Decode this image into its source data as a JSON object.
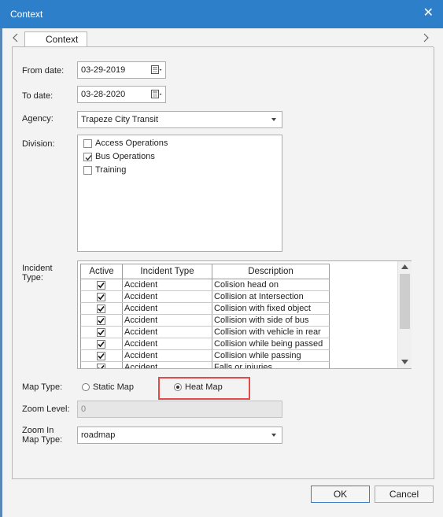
{
  "window": {
    "title": "Context",
    "close_glyph": "✕"
  },
  "tabs": [
    {
      "label": "Context",
      "active": true
    }
  ],
  "form": {
    "from_date": {
      "label": "From date:",
      "value": "03-29-2019"
    },
    "to_date": {
      "label": "To date:",
      "value": "03-28-2020"
    },
    "agency": {
      "label": "Agency:",
      "value": "Trapeze City Transit"
    },
    "division": {
      "label": "Division:",
      "items": [
        {
          "label": "Access Operations",
          "checked": false
        },
        {
          "label": "Bus Operations",
          "checked": true
        },
        {
          "label": "Training",
          "checked": false
        }
      ]
    },
    "incident_type": {
      "label_line1": "Incident",
      "label_line2": "Type:",
      "columns": [
        "Active",
        "Incident Type",
        "Description"
      ],
      "rows": [
        {
          "active": true,
          "type": "Accident",
          "description": "Colision head on"
        },
        {
          "active": true,
          "type": "Accident",
          "description": "Collision at Intersection"
        },
        {
          "active": true,
          "type": "Accident",
          "description": "Collision with fixed object"
        },
        {
          "active": true,
          "type": "Accident",
          "description": "Collision with side of bus"
        },
        {
          "active": true,
          "type": "Accident",
          "description": "Collision with vehicle in rear"
        },
        {
          "active": true,
          "type": "Accident",
          "description": "Collision while being passed"
        },
        {
          "active": true,
          "type": "Accident",
          "description": "Collision while passing"
        },
        {
          "active": true,
          "type": "Accident",
          "description": "Falls or injuries"
        }
      ]
    },
    "map_type": {
      "label": "Map Type:",
      "options": [
        {
          "label": "Static Map",
          "selected": false
        },
        {
          "label": "Heat Map",
          "selected": true
        }
      ]
    },
    "zoom_level": {
      "label": "Zoom Level:",
      "value": "0"
    },
    "zoom_in_map_type": {
      "label_line1": "Zoom In",
      "label_line2": "Map Type:",
      "value": "roadmap"
    }
  },
  "buttons": {
    "ok": "OK",
    "cancel": "Cancel"
  },
  "colors": {
    "titlebar": "#2d7fc9",
    "highlight": "#e24b4b"
  }
}
